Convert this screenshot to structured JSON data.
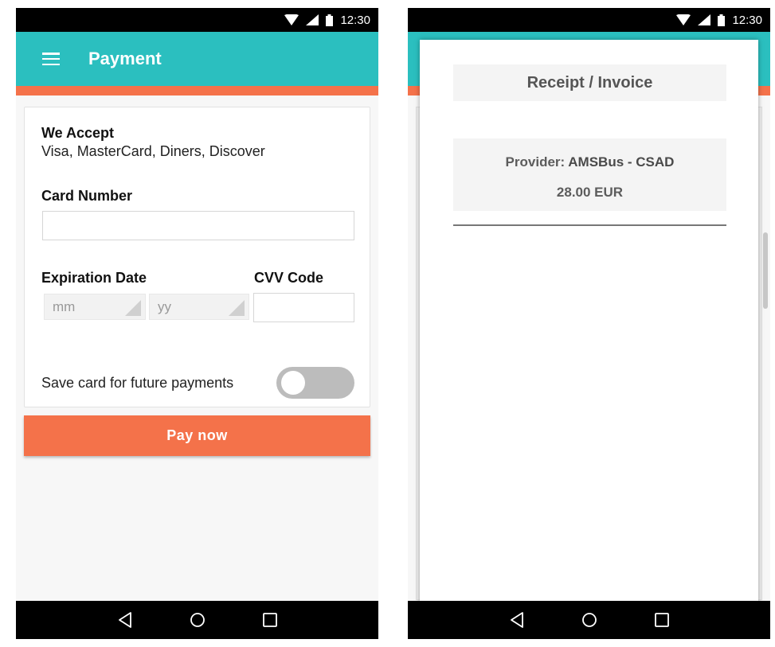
{
  "status_bar": {
    "time": "12:30"
  },
  "payment_screen": {
    "title": "Payment",
    "we_accept_label": "We Accept",
    "accepted_cards": "Visa, MasterCard, Diners, Discover",
    "card_number_label": "Card Number",
    "card_number_value": "",
    "expiration_label": "Expiration Date",
    "month_placeholder": "mm",
    "year_placeholder": "yy",
    "cvv_label": "CVV Code",
    "cvv_value": "",
    "save_card_label": "Save card for future payments",
    "save_card_enabled": false,
    "pay_button": "Pay now"
  },
  "receipt_screen": {
    "title": "Receipt / Invoice",
    "provider_label": "Provider:",
    "provider_name": "AMSBus - CSAD",
    "amount": "28.00 EUR"
  },
  "colors": {
    "primary": "#2bbfbf",
    "accent": "#f4724a"
  },
  "icons": {
    "menu": "menu-icon",
    "wifi": "wifi-icon",
    "signal": "signal-icon",
    "battery": "battery-icon",
    "back": "back-icon",
    "home": "home-icon",
    "recents": "recents-icon"
  }
}
